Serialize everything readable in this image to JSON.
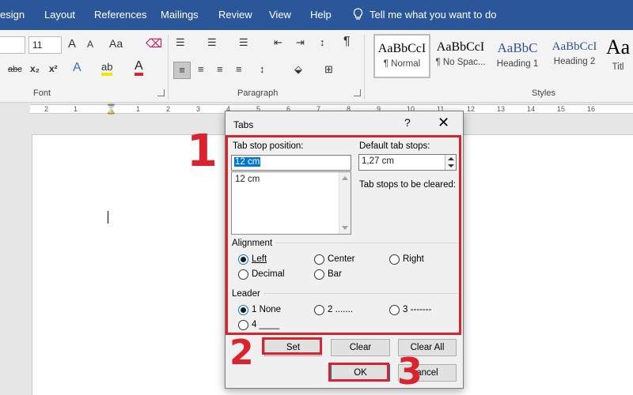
{
  "ribbon_tabs": [
    "esign",
    "Layout",
    "References",
    "Mailings",
    "Review",
    "View",
    "Help"
  ],
  "tell_me": "Tell me what you want to do",
  "font_group": {
    "label": "Font",
    "font_size": "11",
    "glyphs": {
      "grow": "A",
      "shrink": "A",
      "case": "Aa",
      "strike": "abc",
      "sub": "x₂",
      "sup": "x²",
      "effects": "A",
      "highlight": "ab",
      "color": "A"
    }
  },
  "paragraph_group": {
    "label": "Paragraph",
    "show_marks": "¶"
  },
  "styles_group": {
    "label": "Styles",
    "tiles": [
      {
        "sample": "AaBbCcI",
        "name": "¶ Normal"
      },
      {
        "sample": "AaBbCcI",
        "name": "¶ No Spac..."
      },
      {
        "sample": "AaBbC",
        "name": "Heading 1"
      },
      {
        "sample": "AaBbCcI",
        "name": "Heading 2"
      },
      {
        "sample": "Aa",
        "name": "Titl"
      }
    ]
  },
  "ruler_numbers": [
    "2",
    "1",
    "1",
    "2",
    "3",
    "4",
    "5",
    "6",
    "7",
    "8",
    "9",
    "10",
    "11",
    "12",
    "13",
    "14",
    "15",
    "16"
  ],
  "dialog": {
    "title": "Tabs",
    "help": "?",
    "close": "✕",
    "tab_stop_position_label": "Tab stop position:",
    "tab_stop_position_value": "12 cm",
    "tab_stops_list": [
      "12 cm"
    ],
    "default_tab_stops_label": "Default tab stops:",
    "default_tab_stops_value": "1,27 cm",
    "tab_stops_cleared_label": "Tab stops to be cleared:",
    "alignment_label": "Alignment",
    "alignment_options": [
      "Left",
      "Center",
      "Right",
      "Decimal",
      "Bar"
    ],
    "alignment_selected": "Left",
    "leader_label": "Leader",
    "leader_options": [
      "1 None",
      "2 .......",
      "3 -------",
      "4 ____"
    ],
    "leader_selected": "1 None",
    "buttons": {
      "set": "Set",
      "clear": "Clear",
      "clear_all": "Clear All",
      "ok": "OK",
      "cancel": "ancel"
    }
  },
  "annotations": [
    "1",
    "2",
    "3"
  ],
  "colors": {
    "ribbon": "#2b579a",
    "annotation": "#d9232e",
    "selection": "#0078d7"
  }
}
